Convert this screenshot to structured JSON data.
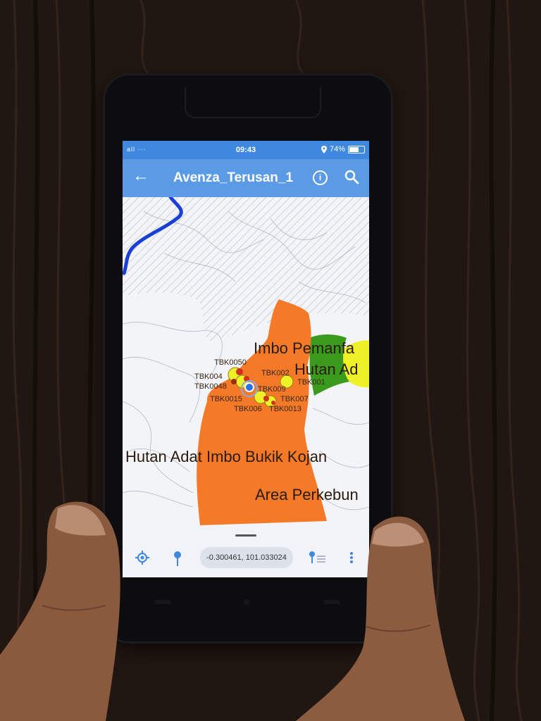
{
  "status_bar": {
    "signal": "all ···",
    "time": "09:43",
    "battery": "74%",
    "battery_level": 0.74
  },
  "app_bar": {
    "title": "Avenza_Terusan_1",
    "info_glyph": "i"
  },
  "map": {
    "region_labels": [
      "Imbo Pemanfa",
      "Hutan Ad",
      "Hutan Adat Imbo Bukik Kojan",
      "Area Perkebun"
    ],
    "points": [
      "TBK0050",
      "TBK004",
      "TBK0048",
      "TBK002",
      "TBK001",
      "TBK009",
      "TBK0015",
      "TBK007",
      "TBK006",
      "TBK0013"
    ],
    "colors": {
      "forest_polygon": "#f47a28",
      "green_zone": "#3a9a1c",
      "yellow_zone": "#eef028",
      "river": "#1a3fd6",
      "location_dot": "#2a6ff0"
    }
  },
  "bottom_bar": {
    "coordinates": "-0.300461, 101.033024",
    "icons": [
      "locate-icon",
      "pin-icon",
      "pin-list-icon",
      "more-icon"
    ]
  }
}
